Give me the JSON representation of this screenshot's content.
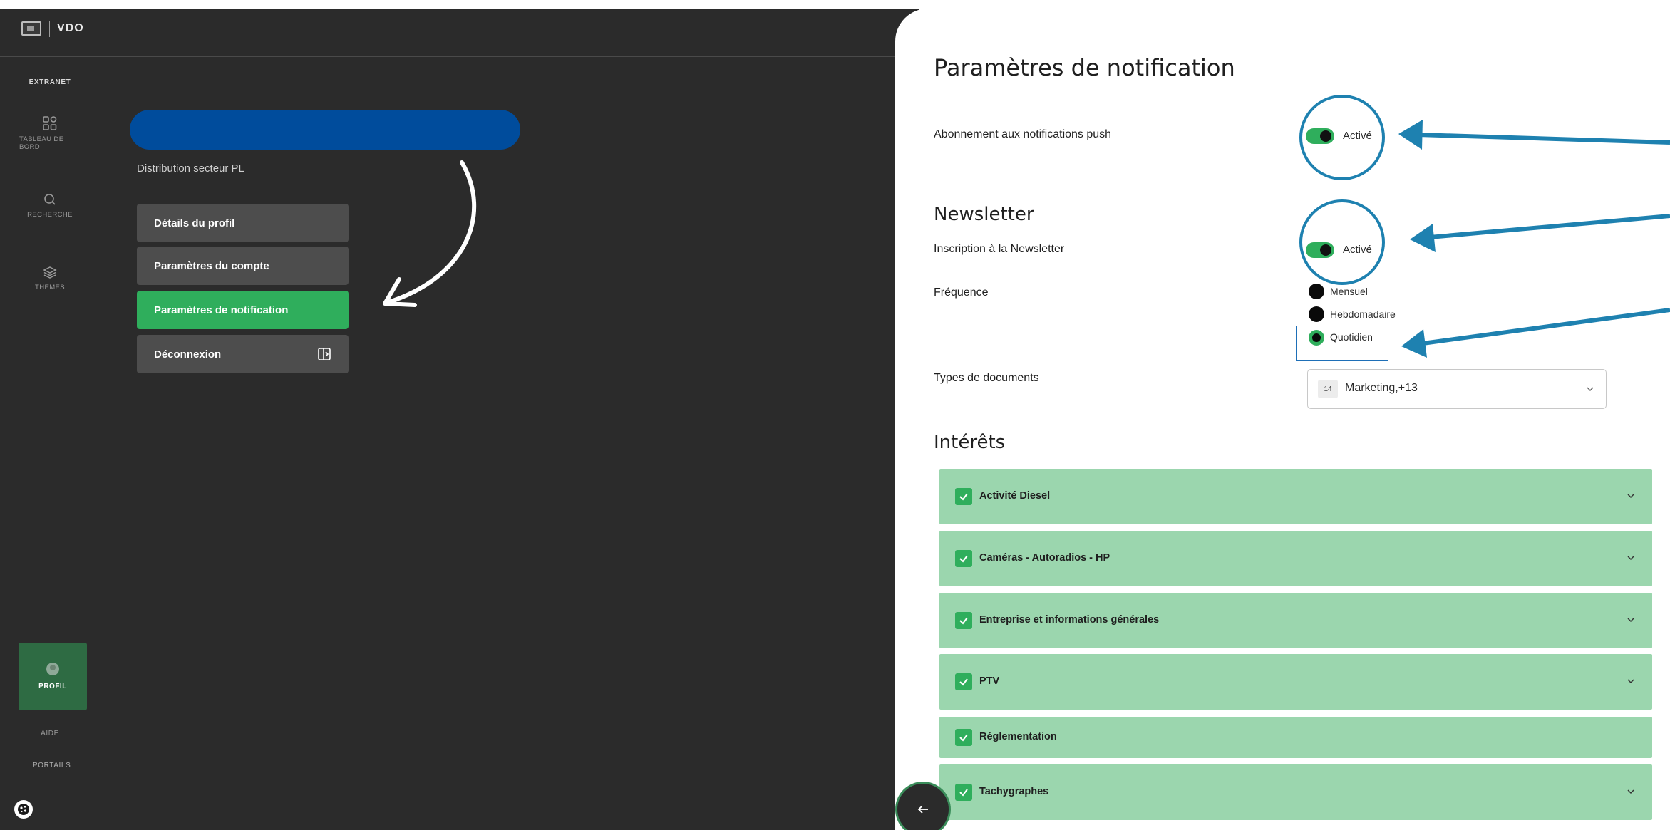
{
  "brand": "VDO",
  "rail": {
    "title": "EXTRANET",
    "items": [
      {
        "label_1": "TABLEAU DE",
        "label_2": "BORD",
        "icon": "dashboard-icon"
      },
      {
        "label_1": "RECHERCHE",
        "icon": "search-icon"
      },
      {
        "label_1": "THÈMES",
        "icon": "layers-icon"
      }
    ],
    "profile": "PROFIL",
    "aide": "AIDE",
    "portails": "PORTAILS"
  },
  "account": {
    "company": "Distribution secteur PL",
    "menu": [
      {
        "label": "Détails du profil",
        "active": false
      },
      {
        "label": "Paramètres du compte",
        "active": false
      },
      {
        "label": "Paramètres de notification",
        "active": true
      },
      {
        "label": "Déconnexion",
        "active": false,
        "icon": "logout-icon"
      }
    ]
  },
  "notifications": {
    "title": "Paramètres de notification",
    "push_label": "Abonnement aux notifications push",
    "push_state": "Activé",
    "newsletter_title": "Newsletter",
    "newsletter_label": "Inscription à la Newsletter",
    "newsletter_state": "Activé",
    "frequency_label": "Fréquence",
    "frequency_options": [
      "Mensuel",
      "Hebdomadaire",
      "Quotidien"
    ],
    "frequency_selected": "Quotidien",
    "doc_types_label": "Types de documents",
    "doc_types_count": "14",
    "doc_types_value": "Marketing,+13",
    "interests_title": "Intérêts",
    "interests": [
      "Activité Diesel",
      "Caméras - Autoradios - HP",
      "Entreprise et informations générales",
      "PTV",
      "Réglementation",
      "Tachygraphes"
    ]
  },
  "colors": {
    "dark_bg": "#2b2b2b",
    "accent_green": "#2fae5c",
    "interest_green": "#9bd6ae",
    "brand_blue": "#004c9c",
    "annotation_blue": "#1e81b0"
  }
}
